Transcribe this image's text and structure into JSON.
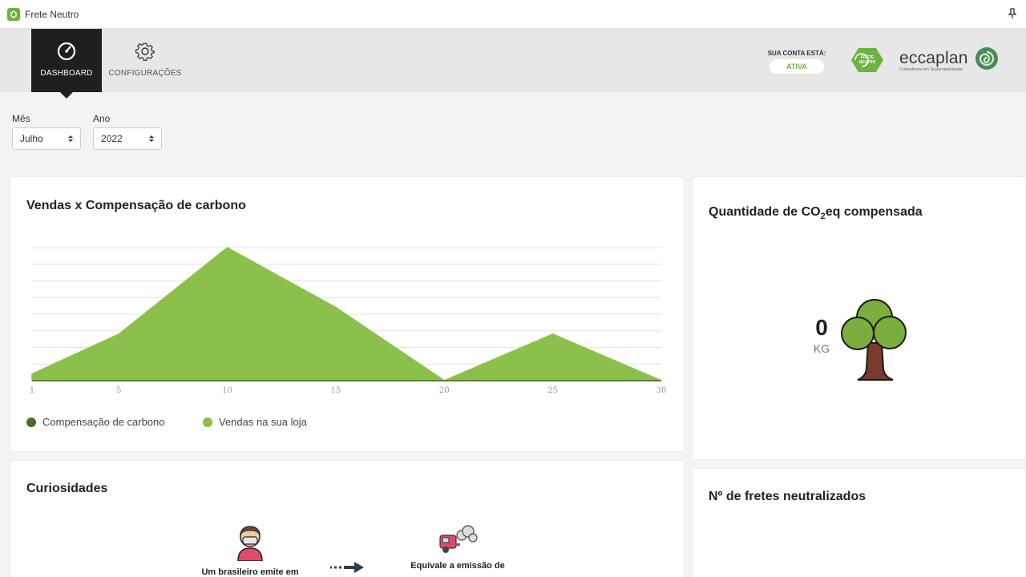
{
  "window": {
    "title": "Frete Neutro"
  },
  "nav": {
    "dashboard_label": "DASHBOARD",
    "config_label": "CONFIGURAÇÕES"
  },
  "account": {
    "label": "SUA CONTA ESTÁ:",
    "status": "ATIVA",
    "badge_text_1": "FRETE",
    "badge_text_2": "NEUTRO"
  },
  "brand": {
    "name": "eccaplan",
    "tagline": "Consultoria em Sustentabilidade"
  },
  "filters": {
    "month_label": "Mês",
    "month_value": "Julho",
    "year_label": "Ano",
    "year_value": "2022"
  },
  "sales_card": {
    "title": "Vendas x Compensação de carbono"
  },
  "co2_card": {
    "title_prefix": "Quantidade de CO",
    "title_sub": "2",
    "title_suffix": "eq compensada",
    "value": "0",
    "unit": "KG"
  },
  "fretes_card": {
    "title": "Nº de fretes neutralizados"
  },
  "curio_card": {
    "title": "Curiosidades",
    "text_left": "Um brasileiro emite em",
    "text_right": "Equivale a emissão de"
  },
  "chart_data": {
    "type": "area",
    "x": [
      1,
      5,
      10,
      15,
      20,
      25,
      30
    ],
    "xticks": [
      "1",
      "5",
      "10",
      "15",
      "20",
      "25",
      "30"
    ],
    "xlim": [
      1,
      30
    ],
    "series": [
      {
        "name": "Compensação de carbono",
        "color": "#4c6b2b",
        "values": [
          0,
          0,
          0,
          0,
          0,
          0,
          0
        ]
      },
      {
        "name": "Vendas na sua loja",
        "color": "#8bc04b",
        "values": [
          0.05,
          0.35,
          1.0,
          0.55,
          0.0,
          0.35,
          0.0
        ]
      }
    ],
    "ylim": [
      0,
      1
    ],
    "grid": true,
    "legend_position": "bottom"
  },
  "colors": {
    "accent": "#6cb33f",
    "area_fill": "#8bc04b",
    "legend_dark": "#4c6b2b",
    "tree_canopy": "#7cae3e",
    "tree_trunk": "#7a3b2e"
  }
}
